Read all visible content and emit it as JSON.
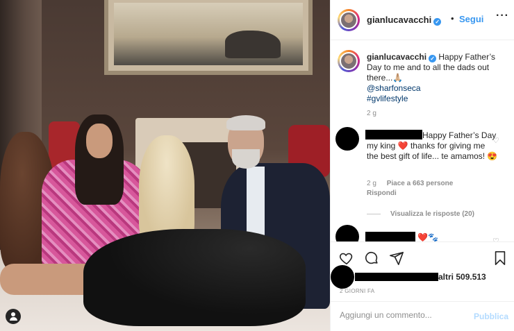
{
  "header": {
    "username": "gianlucavacchi",
    "separator": "•",
    "follow_label": "Segui",
    "more_label": "···"
  },
  "caption": {
    "username": "gianlucavacchi",
    "text": "Happy Father’s Day to me and to all the dads out there...🙏🏼",
    "tags": [
      "@sharfonseca",
      "#gvlifestyle"
    ],
    "time": "2 g"
  },
  "comments": [
    {
      "text_line": "Happy Father’s Day my king ❤️ thanks for giving me the best gift of life... te amamos! 😍",
      "time": "2 g",
      "likes": "Piace a 663 persone",
      "reply_label": "Rispondi",
      "view_replies": "Visualizza le risposte (20)"
    },
    {
      "text_line": "❤️🐾"
    }
  ],
  "actions": {
    "likes_suffix": "altri 509.513",
    "posted_ago": "2 GIORNI FA"
  },
  "composer": {
    "placeholder": "Aggiungi un commento...",
    "publish_label": "Pubblica"
  },
  "colors": {
    "accent": "#3897f0",
    "publish_disabled": "#b3dbff",
    "heart_red": "#ed4956"
  },
  "icons": [
    "verified-badge-icon",
    "heart-icon",
    "comment-icon",
    "share-icon",
    "bookmark-icon",
    "tag-user-icon",
    "more-options-icon"
  ]
}
